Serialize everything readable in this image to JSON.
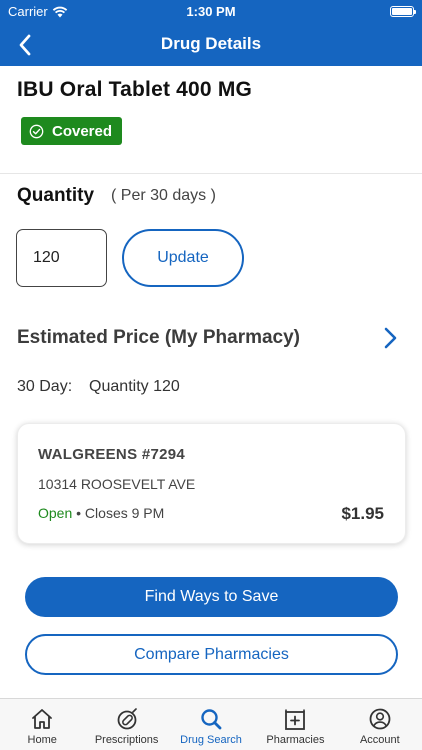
{
  "status_bar": {
    "carrier": "Carrier",
    "time": "1:30 PM"
  },
  "nav": {
    "title": "Drug Details"
  },
  "drug": {
    "name": "IBU Oral Tablet 400 MG",
    "coverage_badge": "Covered"
  },
  "quantity": {
    "label": "Quantity",
    "period": "( Per 30 days )",
    "value": "120",
    "update_label": "Update"
  },
  "estimated_price": {
    "label": "Estimated Price (My Pharmacy)",
    "period_label": "30 Day:",
    "quantity_text": "Quantity 120"
  },
  "pharmacy": {
    "name": "WALGREENS #7294",
    "address": "10314 ROOSEVELT AVE",
    "status": "Open",
    "hours": "• Closes 9 PM",
    "price": "$1.95"
  },
  "actions": {
    "find_ways": "Find Ways to Save",
    "compare": "Compare Pharmacies"
  },
  "tabs": [
    {
      "label": "Home",
      "icon": "home-icon"
    },
    {
      "label": "Prescriptions",
      "icon": "pill-icon"
    },
    {
      "label": "Drug Search",
      "icon": "search-icon",
      "active": true
    },
    {
      "label": "Pharmacies",
      "icon": "pharmacy-icon"
    },
    {
      "label": "Account",
      "icon": "account-icon"
    }
  ],
  "colors": {
    "primary": "#1565c0",
    "covered_green": "#1e8a1e",
    "open_green": "#1e8a1e"
  }
}
